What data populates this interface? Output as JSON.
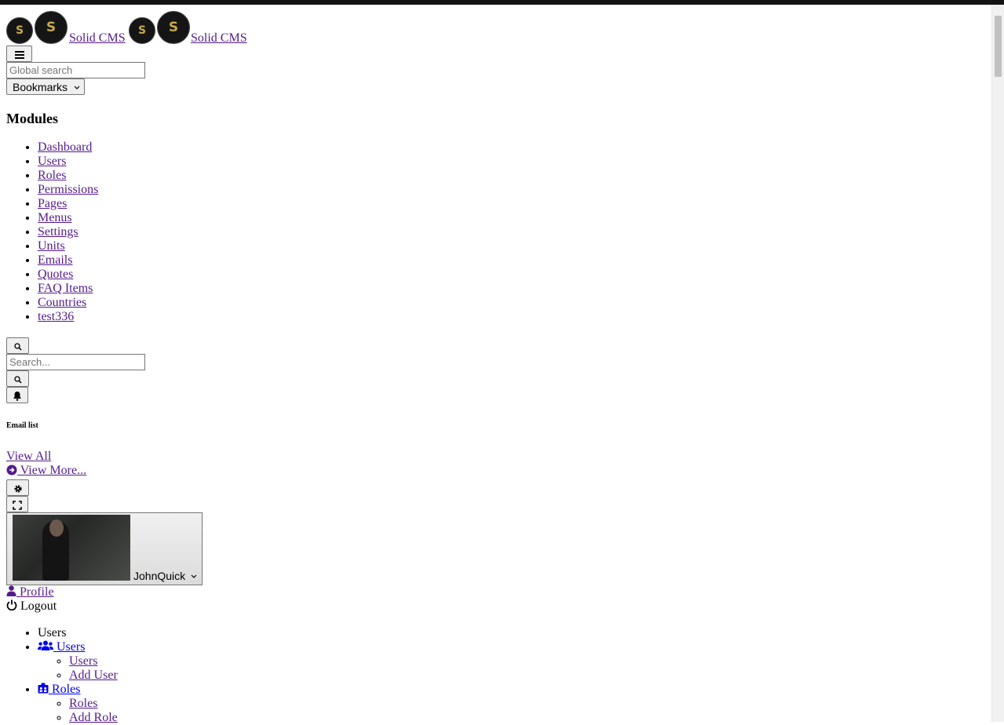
{
  "header": {
    "brand": "Solid CMS",
    "logo_monogram": "S",
    "hamburger_icon": "bars-icon",
    "global_search_placeholder": "Global search",
    "bookmarks_label": "Bookmarks",
    "bookmarks_chevron": "chevron-down-icon"
  },
  "modules": {
    "title": "Modules",
    "items": [
      "Dashboard",
      "Users",
      "Roles",
      "Permissions",
      "Pages",
      "Menus",
      "Settings",
      "Units",
      "Emails",
      "Quotes",
      "FAQ Items",
      "Countries",
      "test336"
    ]
  },
  "search": {
    "placeholder": "Search..."
  },
  "notifications": {
    "title": "Email list",
    "view_all": "View All",
    "view_more": " View More..."
  },
  "user": {
    "name": "JohnQuick",
    "profile_label": " Profile",
    "logout_label": "Logout"
  },
  "menu": {
    "section": "Users",
    "groups": [
      {
        "label": " Users",
        "icon": "users-icon",
        "children": [
          "Users",
          "Add User"
        ]
      },
      {
        "label": " Roles",
        "icon": "id-badge-icon",
        "children": [
          "Roles",
          "Add Role"
        ]
      }
    ]
  },
  "colors": {
    "link_visited": "#551a8b",
    "link": "#0000ee",
    "topbar": "#141414",
    "logo_gold": "#c9a94b"
  }
}
